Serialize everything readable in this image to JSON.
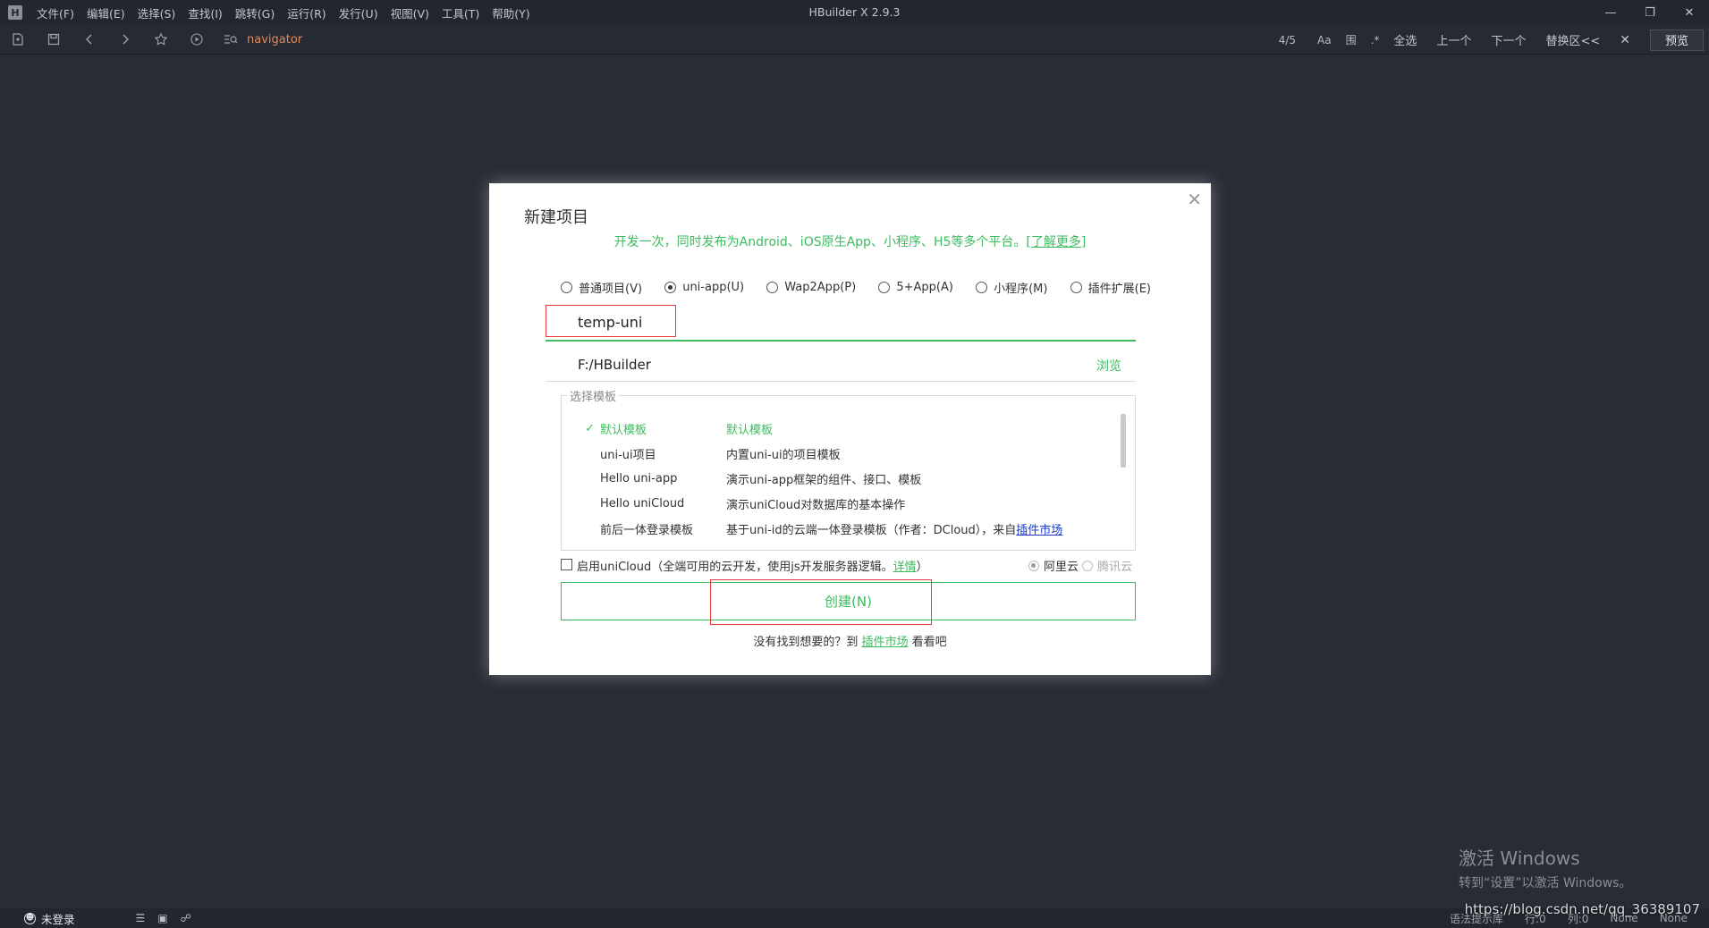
{
  "titlebar": {
    "logo": "H",
    "title": "HBuilder X 2.9.3",
    "menu": [
      "文件(F)",
      "编辑(E)",
      "选择(S)",
      "查找(I)",
      "跳转(G)",
      "运行(R)",
      "发行(U)",
      "视图(V)",
      "工具(T)",
      "帮助(Y)"
    ]
  },
  "toolbar": {
    "navigator": "navigator",
    "find_count": "4/5",
    "opt_case": "Aa",
    "opt_word": "围",
    "buttons": {
      "select_all": "全选",
      "prev": "上一个",
      "next": "下一个",
      "replace": "替换区<<"
    },
    "preview": "预览"
  },
  "dialog": {
    "title": "新建项目",
    "subtitle": "开发一次，同时发布为Android、iOS原生App、小程序、H5等多个平台。",
    "learn_more": "[了解更多]",
    "project_types": [
      {
        "label": "普通项目(V)",
        "checked": false
      },
      {
        "label": "uni-app(U)",
        "checked": true
      },
      {
        "label": "Wap2App(P)",
        "checked": false
      },
      {
        "label": "5+App(A)",
        "checked": false
      },
      {
        "label": "小程序(M)",
        "checked": false
      },
      {
        "label": "插件扩展(E)",
        "checked": false
      }
    ],
    "project_name": "temp-uni",
    "project_path": "F:/HBuilder",
    "browse": "浏览",
    "template_legend": "选择模板",
    "templates": [
      {
        "check": "✓",
        "name": "默认模板",
        "desc": "默认模板"
      },
      {
        "check": "",
        "name": "uni-ui项目",
        "desc": "内置uni-ui的项目模板"
      },
      {
        "check": "",
        "name": "Hello uni-app",
        "desc": "演示uni-app框架的组件、接口、模板"
      },
      {
        "check": "",
        "name": "Hello uniCloud",
        "desc": "演示uniCloud对数据库的基本操作"
      },
      {
        "check": "",
        "name": "前后一体登录模板",
        "desc": "基于uni-id的云端一体登录模板（作者：DCloud），来自",
        "link": "插件市场"
      }
    ],
    "unicloud": {
      "label": "启用uniCloud（全端可用的云开发，使用js开发服务器逻辑。",
      "detail": "详情",
      "close_paren": "）",
      "aliyun": "阿里云",
      "tencent": "腾讯云"
    },
    "create": "创建(N)",
    "footer_prefix": "没有找到想要的？到 ",
    "footer_link": "插件市场",
    "footer_suffix": " 看看吧"
  },
  "watermark": {
    "title": "激活 Windows",
    "sub": "转到“设置”以激活 Windows。"
  },
  "statusbar": {
    "user": "未登录",
    "syntax": "语法提示库",
    "row": "行:0",
    "col": "列:0",
    "encoding": "None",
    "lang": "None"
  },
  "csdn": "https://blog.csdn.net/qq_36389107"
}
